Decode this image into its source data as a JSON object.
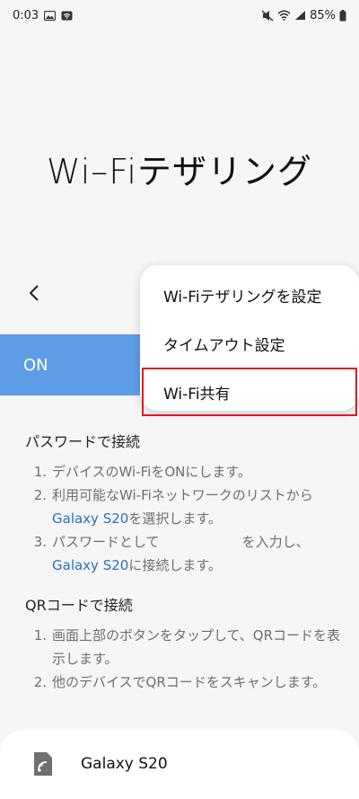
{
  "status_bar": {
    "time": "0:03",
    "battery": "85%"
  },
  "title": "Wi–Fiテザリング",
  "switch": {
    "label": "ON"
  },
  "menu": {
    "items": [
      {
        "label": "Wi-Fiテザリングを設定"
      },
      {
        "label": "タイムアウト設定"
      },
      {
        "label": "Wi-Fi共有"
      }
    ]
  },
  "password_section": {
    "title": "パスワードで接続",
    "steps": {
      "s1": {
        "num": "1.",
        "text": "デバイスのWi-FiをONにします。"
      },
      "s2": {
        "num": "2.",
        "text_a": "利用可能なWi-Fiネットワークのリストから",
        "link": "Galaxy S20",
        "text_b": "を選択します。"
      },
      "s3": {
        "num": "3.",
        "text_a": "パスワードとして",
        "text_b": "を入力し、",
        "link": "Galaxy S20",
        "text_c": "に接続します。"
      }
    }
  },
  "qr_section": {
    "title": "QRコードで接続",
    "steps": {
      "s1": {
        "num": "1.",
        "text": "画面上部のボタンをタップして、QRコードを表示します。"
      },
      "s2": {
        "num": "2.",
        "text": "他のデバイスでQRコードをスキャンします。"
      }
    }
  },
  "device": {
    "name": "Galaxy S20",
    "icon": "device-share-icon"
  }
}
